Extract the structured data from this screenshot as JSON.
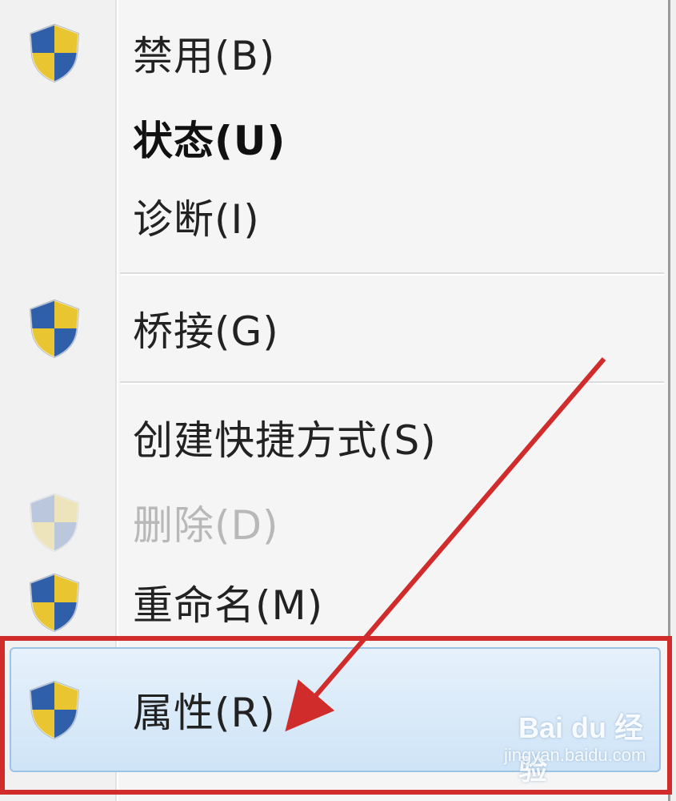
{
  "menu": {
    "items": [
      {
        "label": "禁用(B)",
        "icon": "shield-icon",
        "bold": false,
        "disabled": false
      },
      {
        "label": "状态(U)",
        "icon": null,
        "bold": true,
        "disabled": false
      },
      {
        "label": "诊断(I)",
        "icon": null,
        "bold": false,
        "disabled": false
      },
      {
        "label": "桥接(G)",
        "icon": "shield-icon",
        "bold": false,
        "disabled": false
      },
      {
        "label": "创建快捷方式(S)",
        "icon": null,
        "bold": false,
        "disabled": false
      },
      {
        "label": "删除(D)",
        "icon": "shield-icon",
        "bold": false,
        "disabled": true
      },
      {
        "label": "重命名(M)",
        "icon": "shield-icon",
        "bold": false,
        "disabled": false
      },
      {
        "label": "属性(R)",
        "icon": "shield-icon",
        "bold": false,
        "disabled": false,
        "highlighted": true
      }
    ]
  },
  "colors": {
    "annotation_red": "#d12c2c",
    "highlight_blue": "#cfe4f7",
    "shield_blue": "#2f5fa8",
    "shield_yellow": "#e8c531"
  },
  "watermark": {
    "logo": "Bai du 经验",
    "url": "jingyan.baidu.com"
  }
}
